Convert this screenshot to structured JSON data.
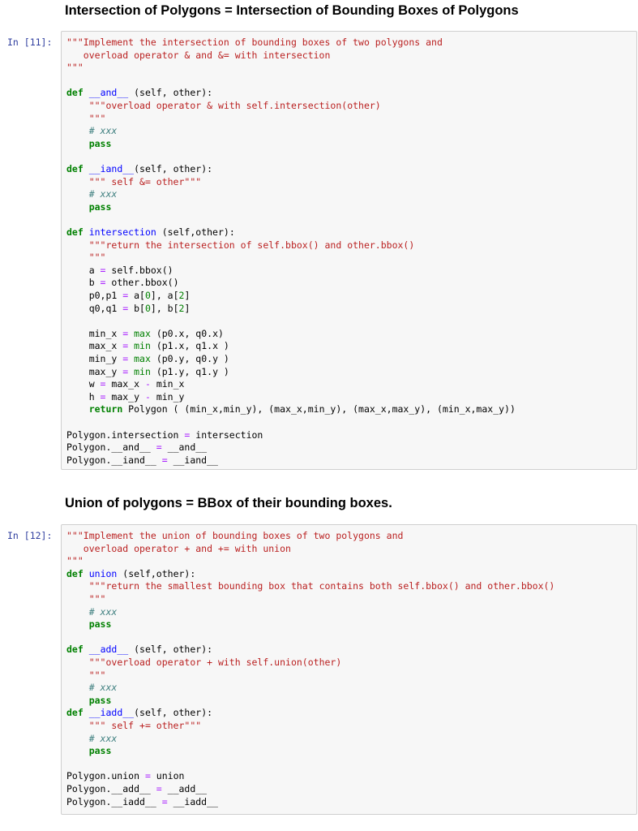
{
  "headings": {
    "intersection": "Intersection of Polygons = Intersection of Bounding Boxes of Polygons",
    "union": "Union of polygons = BBox of their bounding boxes."
  },
  "cells": [
    {
      "prompt": "In [11]:",
      "lines": [
        [
          [
            "s",
            "\"\"\"Implement the intersection of bounding boxes of two polygons and"
          ]
        ],
        [
          [
            "s",
            "   overload operator & and &= with intersection"
          ]
        ],
        [
          [
            "s",
            "\"\"\""
          ]
        ],
        [],
        [
          [
            "k",
            "def"
          ],
          [
            "t",
            " "
          ],
          [
            "f",
            "__and__"
          ],
          [
            "t",
            " (self, other):"
          ]
        ],
        [
          [
            "t",
            "    "
          ],
          [
            "s",
            "\"\"\"overload operator & with self.intersection(other)"
          ]
        ],
        [
          [
            "s",
            "    \"\"\""
          ]
        ],
        [
          [
            "t",
            "    "
          ],
          [
            "c",
            "# xxx"
          ]
        ],
        [
          [
            "t",
            "    "
          ],
          [
            "k",
            "pass"
          ]
        ],
        [],
        [
          [
            "k",
            "def"
          ],
          [
            "t",
            " "
          ],
          [
            "f",
            "__iand__"
          ],
          [
            "t",
            "(self, other):"
          ]
        ],
        [
          [
            "t",
            "    "
          ],
          [
            "s",
            "\"\"\" self &= other\"\"\""
          ]
        ],
        [
          [
            "t",
            "    "
          ],
          [
            "c",
            "# xxx"
          ]
        ],
        [
          [
            "t",
            "    "
          ],
          [
            "k",
            "pass"
          ]
        ],
        [],
        [
          [
            "k",
            "def"
          ],
          [
            "t",
            " "
          ],
          [
            "f",
            "intersection"
          ],
          [
            "t",
            " (self,other):"
          ]
        ],
        [
          [
            "t",
            "    "
          ],
          [
            "s",
            "\"\"\"return the intersection of self.bbox() and other.bbox()"
          ]
        ],
        [
          [
            "s",
            "    \"\"\""
          ]
        ],
        [
          [
            "t",
            "    a "
          ],
          [
            "o",
            "="
          ],
          [
            "t",
            " self.bbox()"
          ]
        ],
        [
          [
            "t",
            "    b "
          ],
          [
            "o",
            "="
          ],
          [
            "t",
            " other.bbox()"
          ]
        ],
        [
          [
            "t",
            "    p0,p1 "
          ],
          [
            "o",
            "="
          ],
          [
            "t",
            " a["
          ],
          [
            "n",
            "0"
          ],
          [
            "t",
            "], a["
          ],
          [
            "n",
            "2"
          ],
          [
            "t",
            "]"
          ]
        ],
        [
          [
            "t",
            "    q0,q1 "
          ],
          [
            "o",
            "="
          ],
          [
            "t",
            " b["
          ],
          [
            "n",
            "0"
          ],
          [
            "t",
            "], b["
          ],
          [
            "n",
            "2"
          ],
          [
            "t",
            "]"
          ]
        ],
        [],
        [
          [
            "t",
            "    min_x "
          ],
          [
            "o",
            "="
          ],
          [
            "t",
            " "
          ],
          [
            "bi",
            "max"
          ],
          [
            "t",
            " (p0.x, q0.x)"
          ]
        ],
        [
          [
            "t",
            "    max_x "
          ],
          [
            "o",
            "="
          ],
          [
            "t",
            " "
          ],
          [
            "bi",
            "min"
          ],
          [
            "t",
            " (p1.x, q1.x )"
          ]
        ],
        [
          [
            "t",
            "    min_y "
          ],
          [
            "o",
            "="
          ],
          [
            "t",
            " "
          ],
          [
            "bi",
            "max"
          ],
          [
            "t",
            " (p0.y, q0.y )"
          ]
        ],
        [
          [
            "t",
            "    max_y "
          ],
          [
            "o",
            "="
          ],
          [
            "t",
            " "
          ],
          [
            "bi",
            "min"
          ],
          [
            "t",
            " (p1.y, q1.y )"
          ]
        ],
        [
          [
            "t",
            "    w "
          ],
          [
            "o",
            "="
          ],
          [
            "t",
            " max_x "
          ],
          [
            "o",
            "-"
          ],
          [
            "t",
            " min_x"
          ]
        ],
        [
          [
            "t",
            "    h "
          ],
          [
            "o",
            "="
          ],
          [
            "t",
            " max_y "
          ],
          [
            "o",
            "-"
          ],
          [
            "t",
            " min_y"
          ]
        ],
        [
          [
            "t",
            "    "
          ],
          [
            "k",
            "return"
          ],
          [
            "t",
            " Polygon ( (min_x,min_y), (max_x,min_y), (max_x,max_y), (min_x,max_y))"
          ]
        ],
        [],
        [
          [
            "t",
            "Polygon.intersection "
          ],
          [
            "o",
            "="
          ],
          [
            "t",
            " intersection"
          ]
        ],
        [
          [
            "t",
            "Polygon.__and__ "
          ],
          [
            "o",
            "="
          ],
          [
            "t",
            " __and__"
          ]
        ],
        [
          [
            "t",
            "Polygon.__iand__ "
          ],
          [
            "o",
            "="
          ],
          [
            "t",
            " __iand__"
          ]
        ]
      ]
    },
    {
      "prompt": "In [12]:",
      "lines": [
        [
          [
            "s",
            "\"\"\"Implement the union of bounding boxes of two polygons and"
          ]
        ],
        [
          [
            "s",
            "   overload operator + and += with union"
          ]
        ],
        [
          [
            "s",
            "\"\"\""
          ]
        ],
        [
          [
            "k",
            "def"
          ],
          [
            "t",
            " "
          ],
          [
            "f",
            "union"
          ],
          [
            "t",
            " (self,other):"
          ]
        ],
        [
          [
            "t",
            "    "
          ],
          [
            "s",
            "\"\"\"return the smallest bounding box that contains both self.bbox() and other.bbox()"
          ]
        ],
        [
          [
            "s",
            "    \"\"\""
          ]
        ],
        [
          [
            "t",
            "    "
          ],
          [
            "c",
            "# xxx"
          ]
        ],
        [
          [
            "t",
            "    "
          ],
          [
            "k",
            "pass"
          ]
        ],
        [],
        [
          [
            "k",
            "def"
          ],
          [
            "t",
            " "
          ],
          [
            "f",
            "__add__"
          ],
          [
            "t",
            " (self, other):"
          ]
        ],
        [
          [
            "t",
            "    "
          ],
          [
            "s",
            "\"\"\"overload operator + with self.union(other)"
          ]
        ],
        [
          [
            "s",
            "    \"\"\""
          ]
        ],
        [
          [
            "t",
            "    "
          ],
          [
            "c",
            "# xxx"
          ]
        ],
        [
          [
            "t",
            "    "
          ],
          [
            "k",
            "pass"
          ]
        ],
        [
          [
            "k",
            "def"
          ],
          [
            "t",
            " "
          ],
          [
            "f",
            "__iadd__"
          ],
          [
            "t",
            "(self, other):"
          ]
        ],
        [
          [
            "t",
            "    "
          ],
          [
            "s",
            "\"\"\" self += other\"\"\""
          ]
        ],
        [
          [
            "t",
            "    "
          ],
          [
            "c",
            "# xxx"
          ]
        ],
        [
          [
            "t",
            "    "
          ],
          [
            "k",
            "pass"
          ]
        ],
        [],
        [
          [
            "t",
            "Polygon.union "
          ],
          [
            "o",
            "="
          ],
          [
            "t",
            " union"
          ]
        ],
        [
          [
            "t",
            "Polygon.__add__ "
          ],
          [
            "o",
            "="
          ],
          [
            "t",
            " __add__"
          ]
        ],
        [
          [
            "t",
            "Polygon.__iadd__ "
          ],
          [
            "o",
            "="
          ],
          [
            "t",
            " __iadd__"
          ]
        ]
      ]
    }
  ],
  "colors": {
    "keyword": "#008000",
    "string": "#ba2121",
    "function": "#0000ff",
    "comment": "#408080",
    "operator": "#aa22ff",
    "prompt": "#303f9f",
    "cell_bg": "#f7f7f7",
    "cell_border": "#cfcfcf"
  }
}
